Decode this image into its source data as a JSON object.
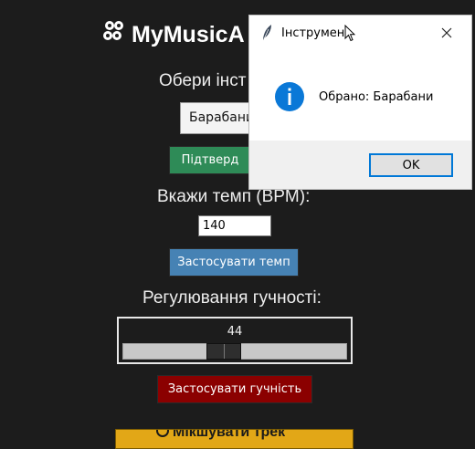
{
  "app": {
    "title": "MyMusicA",
    "logo_icon": "mixer-icon"
  },
  "instrument": {
    "label": "Обери інст",
    "selected": "Барабани",
    "confirm_label": "Підтверд",
    "confirm_color": "#2e8b57"
  },
  "tempo": {
    "label": "Вкажи темп (BPM):",
    "value": "140",
    "apply_label": "Застосувати темп",
    "apply_color": "#4682b4"
  },
  "volume": {
    "label": "Регулювання гучності:",
    "value": "44",
    "min": 0,
    "max": 100,
    "level": 44,
    "apply_label": "Застосувати гучність",
    "apply_color": "#8b0000"
  },
  "mix": {
    "label": "Мікшувати трек",
    "color": "#e2a717"
  },
  "dialog": {
    "title": "Інструмен",
    "message": "Обрано: Барабани",
    "ok_label": "OK",
    "icon": "info-icon",
    "accent": "#0078d7"
  }
}
